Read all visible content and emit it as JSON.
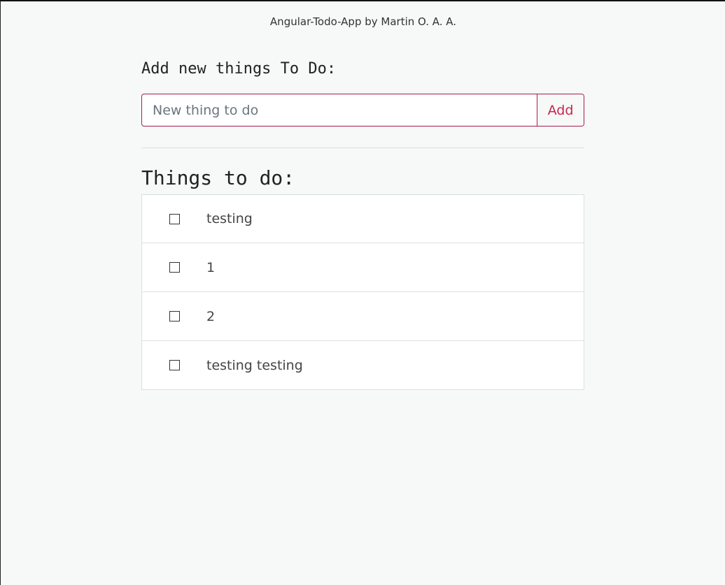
{
  "header": {
    "byline": "Angular-Todo-App by Martin O. A. A."
  },
  "add_section": {
    "heading": "Add new things To Do:",
    "input_placeholder": "New thing to do",
    "input_value": "",
    "add_button_label": "Add"
  },
  "list_section": {
    "heading": "Things to do:",
    "items": [
      {
        "label": "testing",
        "checked": false
      },
      {
        "label": "1",
        "checked": false
      },
      {
        "label": "2",
        "checked": false
      },
      {
        "label": "testing testing",
        "checked": false
      }
    ]
  },
  "colors": {
    "accent": "#c8254b",
    "input_border": "#a61c4d",
    "background": "#f7f8f8"
  }
}
